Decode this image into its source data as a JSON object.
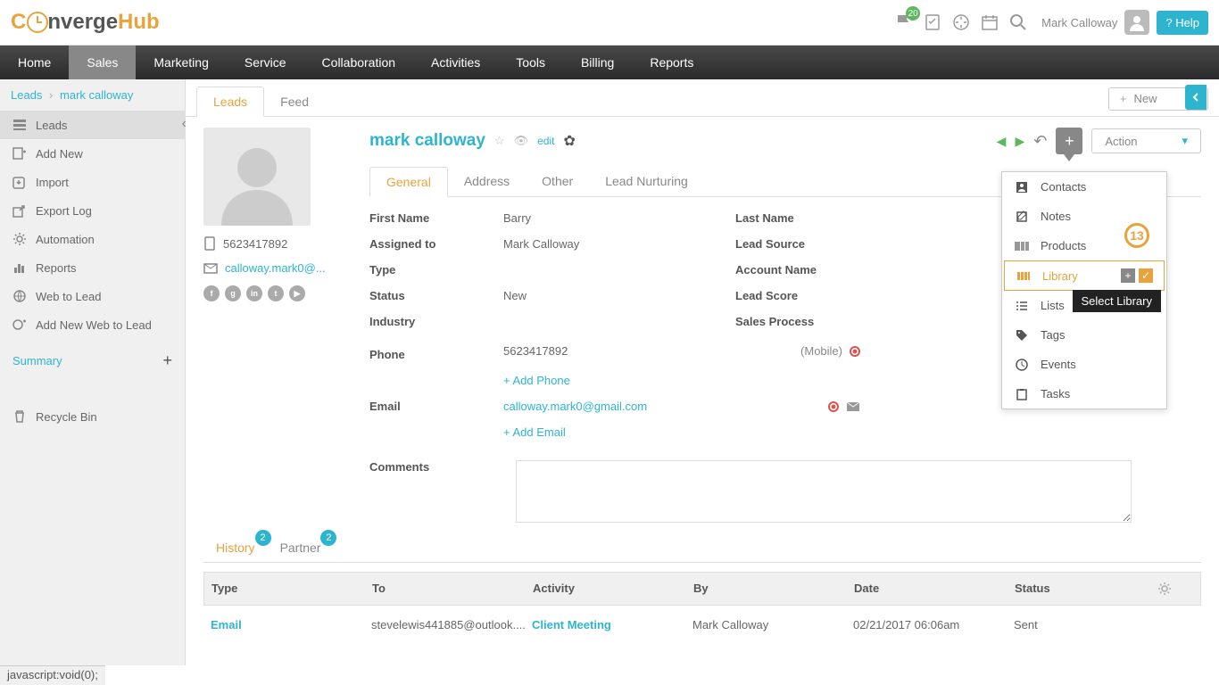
{
  "header": {
    "logo_onverge": "nverge",
    "logo_hub": "Hub",
    "flag_count": "20",
    "user_name": "Mark Calloway",
    "help_label": "? Help"
  },
  "nav": {
    "items": [
      "Home",
      "Sales",
      "Marketing",
      "Service",
      "Collaboration",
      "Activities",
      "Tools",
      "Billing",
      "Reports"
    ],
    "active": "Sales"
  },
  "breadcrumb": {
    "root": "Leads",
    "current": "mark calloway"
  },
  "sidebar": {
    "items": [
      {
        "icon": "list",
        "label": "Leads"
      },
      {
        "icon": "add",
        "label": "Add New"
      },
      {
        "icon": "import",
        "label": "Import"
      },
      {
        "icon": "export",
        "label": "Export Log"
      },
      {
        "icon": "automation",
        "label": "Automation"
      },
      {
        "icon": "reports",
        "label": "Reports"
      },
      {
        "icon": "web",
        "label": "Web to Lead"
      },
      {
        "icon": "addweb",
        "label": "Add New Web to Lead"
      }
    ],
    "summary_label": "Summary",
    "recycle_label": "Recycle Bin"
  },
  "content_tabs": {
    "tabs": [
      "Leads",
      "Feed"
    ],
    "active": "Leads",
    "new_label": "New"
  },
  "profile": {
    "phone": "5623417892",
    "email": "calloway.mark0@..."
  },
  "lead": {
    "title": "mark calloway",
    "edit_label": "edit",
    "action_label": "Action",
    "sub_tabs": [
      "General",
      "Address",
      "Other",
      "Lead Nurturing"
    ],
    "active_sub_tab": "General",
    "fields": {
      "first_name_label": "First Name",
      "first_name_value": "Barry",
      "last_name_label": "Last Name",
      "assigned_to_label": "Assigned to",
      "assigned_to_value": "Mark Calloway",
      "lead_source_label": "Lead Source",
      "type_label": "Type",
      "account_name_label": "Account Name",
      "status_label": "Status",
      "status_value": "New",
      "lead_score_label": "Lead Score",
      "industry_label": "Industry",
      "sales_process_label": "Sales Process",
      "phone_label": "Phone",
      "phone_value": "5623417892",
      "phone_type": "(Mobile)",
      "add_phone": "+ Add Phone",
      "email_label": "Email",
      "email_value": "calloway.mark0@gmail.com",
      "add_email": "+ Add Email",
      "comments_label": "Comments"
    }
  },
  "add_menu": {
    "items": [
      "Contacts",
      "Notes",
      "Products",
      "Library",
      "Lists",
      "Tags",
      "Events",
      "Tasks"
    ],
    "highlighted": "Library"
  },
  "step_badge": "13",
  "tooltip": "Select Library",
  "bottom_tabs": {
    "history_label": "History",
    "history_badge": "2",
    "partner_label": "Partner",
    "partner_badge": "2"
  },
  "history_table": {
    "headers": [
      "Type",
      "To",
      "Activity",
      "By",
      "Date",
      "Status"
    ],
    "row": {
      "type": "Email",
      "to": "stevelewis441885@outlook....",
      "activity": "Client Meeting",
      "by": "Mark Calloway",
      "date": "02/21/2017 06:06am",
      "status": "Sent"
    }
  },
  "status_bar": "javascript:void(0);"
}
